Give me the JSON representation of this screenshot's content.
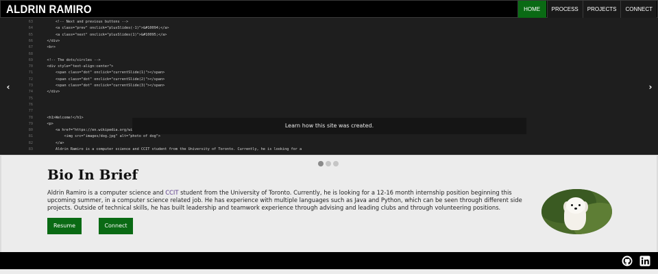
{
  "header": {
    "brand": "ALDRIN RAMIRO",
    "nav": [
      {
        "label": "HOME",
        "active": true
      },
      {
        "label": "PROCESS",
        "active": false
      },
      {
        "label": "PROJECTS",
        "active": false
      },
      {
        "label": "CONNECT",
        "active": false
      }
    ]
  },
  "slideshow": {
    "caption": "Learn how this site was created.",
    "prev_label": "‹",
    "next_label": "›",
    "dots": [
      {
        "active": true
      },
      {
        "active": false
      },
      {
        "active": false
      }
    ],
    "code_lines": [
      {
        "num": "63",
        "text": "        <!-- Next and previous buttons -->"
      },
      {
        "num": "64",
        "text": "        <a class=\"prev\" onclick=\"plusSlides(-1)\">&#10094;</a>"
      },
      {
        "num": "65",
        "text": "        <a class=\"next\" onclick=\"plusSlides(1)\">&#10095;</a>"
      },
      {
        "num": "66",
        "text": "    </div>"
      },
      {
        "num": "67",
        "text": "    <br>"
      },
      {
        "num": "68",
        "text": ""
      },
      {
        "num": "69",
        "text": "    <!-- The dots/circles -->"
      },
      {
        "num": "70",
        "text": "    <div style=\"text-align:center\">"
      },
      {
        "num": "71",
        "text": "        <span class=\"dot\" onclick=\"currentSlide(1)\"></span>"
      },
      {
        "num": "72",
        "text": "        <span class=\"dot\" onclick=\"currentSlide(2)\"></span>"
      },
      {
        "num": "73",
        "text": "        <span class=\"dot\" onclick=\"currentSlide(3)\"></span>"
      },
      {
        "num": "74",
        "text": "    </div>"
      },
      {
        "num": "75",
        "text": ""
      },
      {
        "num": "76",
        "text": ""
      },
      {
        "num": "77",
        "text": ""
      },
      {
        "num": "78",
        "text": "    <h1>Welcome!</h1>"
      },
      {
        "num": "79",
        "text": "    <p>"
      },
      {
        "num": "80",
        "text": "        <a href=\"https://en.wikipedia.org/wiki/Dog\" target=\"_blank\">"
      },
      {
        "num": "81",
        "text": "            <img src=\"images/dog.jpg\" alt=\"photo of dog\">"
      },
      {
        "num": "82",
        "text": "        </a>"
      },
      {
        "num": "83",
        "text": "        Aldrin Ramiro is a computer science and CCIT student from the University of Toronto. Currently, he is looking for a"
      }
    ]
  },
  "bio": {
    "title": "Bio In Brief",
    "text_part1": "Aldrin Ramiro is a computer science and ",
    "link": "CCIT",
    "text_part2": " student from the University of Toronto. Currently, he is looking for a 12-16 month internship position beginning this upcoming summer, in a computer science related job. He has experience with multiple languages such as Java and Python, which can be seen through different side projects. Outside of technical skills, he has built leadership and teamwork experience through advising and leading clubs and through volunteering positions.",
    "resume_label": "Resume",
    "connect_label": "Connect",
    "photo_icon": "dog-photo"
  },
  "footer": {
    "icons": [
      "github-icon",
      "linkedin-icon"
    ]
  },
  "colors": {
    "accent": "#0a6a14",
    "nav_bg": "#000000",
    "code_bg": "#1e1e1e",
    "page_bg": "#ececec"
  }
}
